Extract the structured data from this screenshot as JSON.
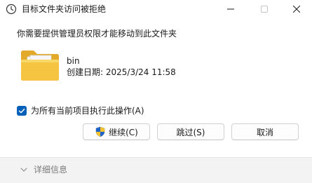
{
  "window": {
    "title": "目标文件夹访问被拒绝",
    "title_icon": "clock-icon"
  },
  "message": "你需要提供管理员权限才能移动到此文件夹",
  "file": {
    "icon": "folder-icon",
    "name": "bin",
    "date_label": "创建日期: ",
    "date_value": "2025/3/24 11:58"
  },
  "checkbox": {
    "checked": true,
    "label": "为所有当前项目执行此操作(A)"
  },
  "buttons": {
    "continue_label": "继续(C)",
    "skip_label": "跳过(S)",
    "cancel_label": "取消"
  },
  "footer": {
    "details_label": "详细信息"
  },
  "colors": {
    "accent": "#005fb8",
    "footer_bg": "#f3f3f3",
    "folder_yellow": "#f5c542",
    "folder_back": "#e2a92a"
  }
}
